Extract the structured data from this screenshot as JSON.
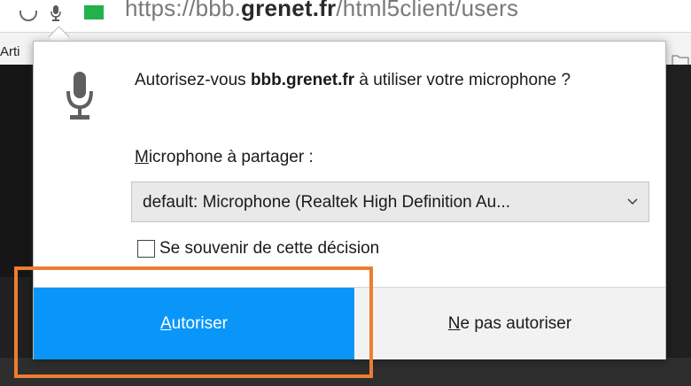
{
  "browser": {
    "url_prefix": "https://bbb.",
    "url_host_domain": "grenet.fr",
    "url_path": "/html5client/users",
    "bookmark_label": "Arti"
  },
  "dialog": {
    "prompt_before": "Autorisez-vous ",
    "prompt_host": "bbb.grenet.fr",
    "prompt_after": " à utiliser votre microphone ?",
    "share_label_accesskey": "M",
    "share_label_rest": "icrophone à partager :",
    "selected_device": "default: Microphone (Realtek High Definition Au...",
    "remember_label": "Se souvenir de cette décision",
    "remember_checked": false,
    "allow_accesskey": "A",
    "allow_rest": "utoriser",
    "deny_accesskey": "N",
    "deny_rest": "e pas autoriser"
  },
  "colors": {
    "allow_button": "#0996f8",
    "highlight": "#ed7d31",
    "secure_indicator": "#22b14c"
  }
}
